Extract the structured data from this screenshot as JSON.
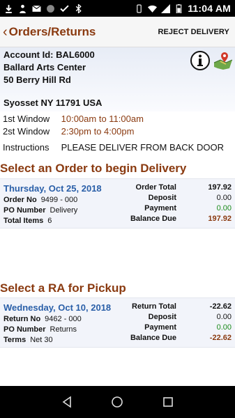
{
  "status_bar": {
    "time": "11:04 AM"
  },
  "header": {
    "title": "Orders/Returns",
    "reject_label": "REJECT DELIVERY"
  },
  "account": {
    "id_label": "Account Id:",
    "id_value": "BAL6000",
    "name": "Ballard Arts Center",
    "address": "50 Berry Hill Rd",
    "city_line": "Syosset  NY  11791  USA"
  },
  "windows": [
    {
      "label": "1st Window",
      "value": "10:00am to 11:00am"
    },
    {
      "label": "2st Window",
      "value": "2:30pm to 4:00pm"
    }
  ],
  "instructions": {
    "label": "Instructions",
    "value": "PLEASE DELIVER FROM BACK DOOR"
  },
  "orders_section": {
    "title": "Select an Order to begin Delivery"
  },
  "order": {
    "date": "Thursday, Oct 25, 2018",
    "order_no_label": "Order No",
    "order_no": "9499 - 000",
    "po_label": "PO Number",
    "po": "Delivery",
    "items_label": "Total Items",
    "items": "6",
    "total_label": "Order Total",
    "total": "197.92",
    "deposit_label": "Deposit",
    "deposit": "0.00",
    "payment_label": "Payment",
    "payment": "0.00",
    "balance_label": "Balance Due",
    "balance": "197.92"
  },
  "ra_section": {
    "title": "Select a RA for Pickup"
  },
  "ra": {
    "date": "Wednesday, Oct 10, 2018",
    "return_no_label": "Return No",
    "return_no": "9462 - 000",
    "po_label": "PO Number",
    "po": "Returns",
    "terms_label": "Terms",
    "terms": "Net 30",
    "total_label": "Return Total",
    "total": "-22.62",
    "deposit_label": "Deposit",
    "deposit": "0.00",
    "payment_label": "Payment",
    "payment": "0.00",
    "balance_label": "Balance Due",
    "balance": "-22.62"
  },
  "colors": {
    "accent": "#8a3a10",
    "date_blue": "#2a5fa8",
    "green": "#1a8a1a"
  },
  "icons": [
    "download-icon",
    "person-icon",
    "mail-icon",
    "circle-icon",
    "check-icon",
    "bluetooth-icon",
    "vibrate-icon",
    "wifi-icon",
    "signal-icon",
    "battery-icon",
    "info-icon",
    "map-icon",
    "back-icon",
    "home-icon",
    "recents-icon"
  ]
}
